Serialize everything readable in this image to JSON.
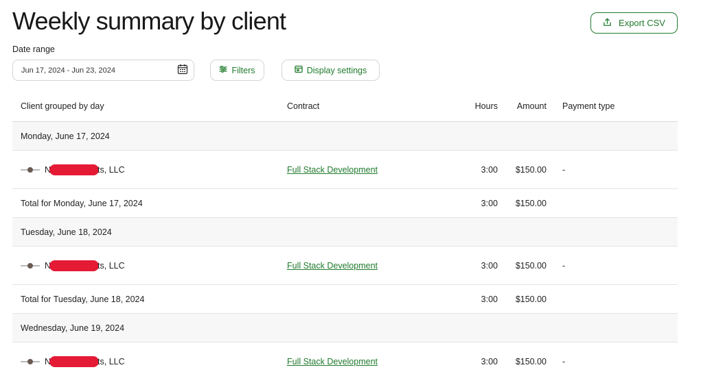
{
  "page": {
    "title": "Weekly summary by client",
    "export_label": "Export CSV",
    "date_range_label": "Date range",
    "date_range_value": "Jun 17, 2024 - Jun 23, 2024",
    "filters_label": "Filters",
    "display_settings_label": "Display settings",
    "accent_color": "#1f7a2c"
  },
  "table": {
    "columns": {
      "client": "Client grouped by day",
      "contract": "Contract",
      "hours": "Hours",
      "amount": "Amount",
      "payment_type": "Payment type"
    },
    "days": [
      {
        "day": "Monday, June 17, 2024",
        "client_prefix": "N",
        "client_suffix": "ts, LLC",
        "contract": "Full Stack Development",
        "hours": "3:00",
        "amount": "$150.00",
        "payment_type": "-",
        "total_label": "Total for Monday, June 17, 2024",
        "total_hours": "3:00",
        "total_amount": "$150.00"
      },
      {
        "day": "Tuesday, June 18, 2024",
        "client_prefix": "N",
        "client_suffix": "ts, LLC",
        "contract": "Full Stack Development",
        "hours": "3:00",
        "amount": "$150.00",
        "payment_type": "-",
        "total_label": "Total for Tuesday, June 18, 2024",
        "total_hours": "3:00",
        "total_amount": "$150.00"
      },
      {
        "day": "Wednesday, June 19, 2024",
        "client_prefix": "N",
        "client_suffix": "ts, LLC",
        "contract": "Full Stack Development",
        "hours": "3:00",
        "amount": "$150.00",
        "payment_type": "-"
      }
    ]
  }
}
